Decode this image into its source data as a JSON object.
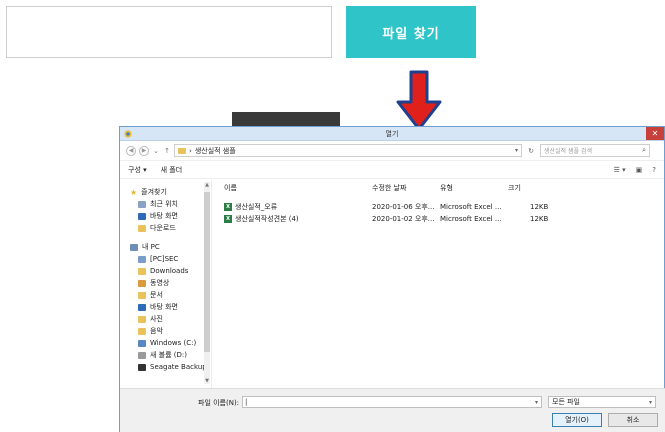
{
  "web": {
    "find_button": "파일 찾기"
  },
  "dialog": {
    "title": "열기",
    "close_glyph": "✕",
    "breadcrumb": "생산실적 샘플",
    "search_placeholder": "생산실적 샘플 검색",
    "toolbar": {
      "organize": "구성 ▾",
      "new_folder": "새 폴더"
    },
    "sidebar": {
      "favorites_head": "즐겨찾기",
      "favorites": [
        "최근 위치",
        "바탕 화면",
        "다운로드"
      ],
      "pc_head": "내 PC",
      "pc_items": [
        "[PC]SEC",
        "Downloads",
        "동영상",
        "문서",
        "바탕 화면",
        "사진",
        "음악",
        "Windows (C:)",
        "새 볼륨 (D:)",
        "Seagate Backup"
      ]
    },
    "columns": {
      "name": "이름",
      "modified": "수정한 날짜",
      "type": "유형",
      "size": "크기"
    },
    "files": [
      {
        "name": "생산실적_오류",
        "modified": "2020-01-06 오후...",
        "type": "Microsoft Excel ...",
        "size": "12KB"
      },
      {
        "name": "생산실적작성견본 (4)",
        "modified": "2020-01-02 오후...",
        "type": "Microsoft Excel ...",
        "size": "12KB"
      }
    ],
    "filename_label": "파일 이름(N):",
    "filter": "모든 파일",
    "open_button": "열기(O)",
    "cancel_button": "취소"
  },
  "colors": {
    "accent": "#2ec4c8",
    "arrow_fill": "#e0201b",
    "arrow_outline": "#1f3f8f"
  },
  "icons": [
    "arrow-down-icon",
    "back-icon",
    "forward-icon",
    "up-icon",
    "folder-icon",
    "refresh-icon",
    "search-icon",
    "star-icon",
    "pc-icon",
    "excel-icon",
    "close-icon"
  ]
}
